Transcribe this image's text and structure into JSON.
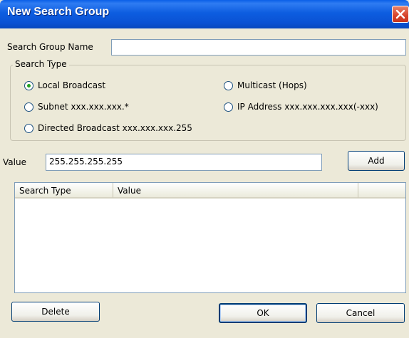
{
  "window": {
    "title": "New Search Group"
  },
  "form": {
    "name_label": "Search Group Name",
    "name_value": "",
    "search_type_title": "Search Type",
    "radios": [
      {
        "label": "Local Broadcast",
        "checked": true
      },
      {
        "label": "Multicast (Hops)",
        "checked": false
      },
      {
        "label": "Subnet xxx.xxx.xxx.*",
        "checked": false
      },
      {
        "label": "IP Address xxx.xxx.xxx.xxx(-xxx)",
        "checked": false
      },
      {
        "label": "Directed Broadcast xxx.xxx.xxx.255",
        "checked": false
      }
    ],
    "value_label": "Value",
    "value_value": "255.255.255.255",
    "add_label": "Add"
  },
  "list": {
    "columns": [
      "Search Type",
      "Value",
      ""
    ]
  },
  "buttons": {
    "delete": "Delete",
    "ok": "OK",
    "cancel": "Cancel"
  },
  "colors": {
    "titlebar": "#0a52d4",
    "window_bg": "#ece9d8",
    "close": "#d6422a"
  },
  "icons": {
    "close": "close-icon"
  }
}
